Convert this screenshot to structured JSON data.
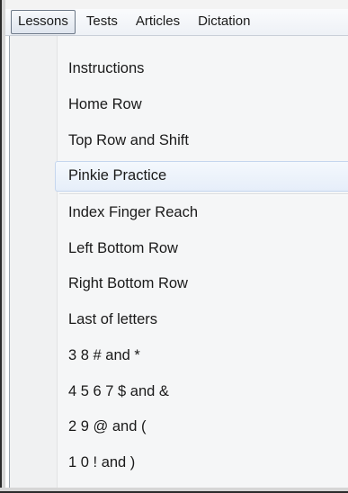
{
  "menubar": {
    "items": [
      {
        "label": "Lessons",
        "active": true
      },
      {
        "label": "Tests",
        "active": false
      },
      {
        "label": "Articles",
        "active": false
      },
      {
        "label": "Dictation",
        "active": false
      }
    ]
  },
  "dropdown": {
    "items": [
      {
        "label": "Instructions"
      },
      {
        "label": "Home Row"
      },
      {
        "label": "Top Row and Shift"
      },
      {
        "label": "Pinkie Practice",
        "highlighted": true
      },
      {
        "label": "Index Finger Reach"
      },
      {
        "label": "Left Bottom Row"
      },
      {
        "label": "Right Bottom Row"
      },
      {
        "label": "Last of letters"
      },
      {
        "label": "3 8 # and *"
      },
      {
        "label": "4 5 6 7 $ and &"
      },
      {
        "label": "2 9 @ and ("
      },
      {
        "label": "1 0 ! and )"
      }
    ]
  },
  "colors": {
    "menubar_bg": "#eef1f6",
    "highlight": "#e6eef9",
    "highlight_border": "#c5d6ee",
    "dropdown_bg": "#f5f6f7"
  }
}
